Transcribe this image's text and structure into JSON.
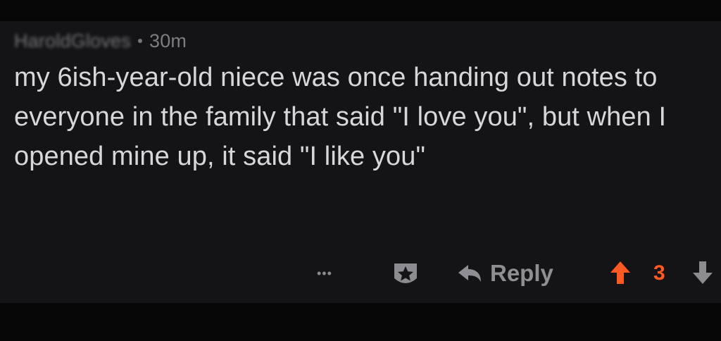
{
  "comment": {
    "username": "HaroldGloves",
    "time": "30m",
    "text": "my 6ish-year-old niece was once handing out notes to everyone in the family that said \"I love you\", but when I opened mine up, it said \"I like you\""
  },
  "actions": {
    "more": "•••",
    "award_icon": "award-icon",
    "reply_label": "Reply",
    "score": "3"
  },
  "colors": {
    "background": "#141416",
    "text": "#d7d7da",
    "muted": "#8f8f93",
    "upvote": "#ff5a24"
  }
}
